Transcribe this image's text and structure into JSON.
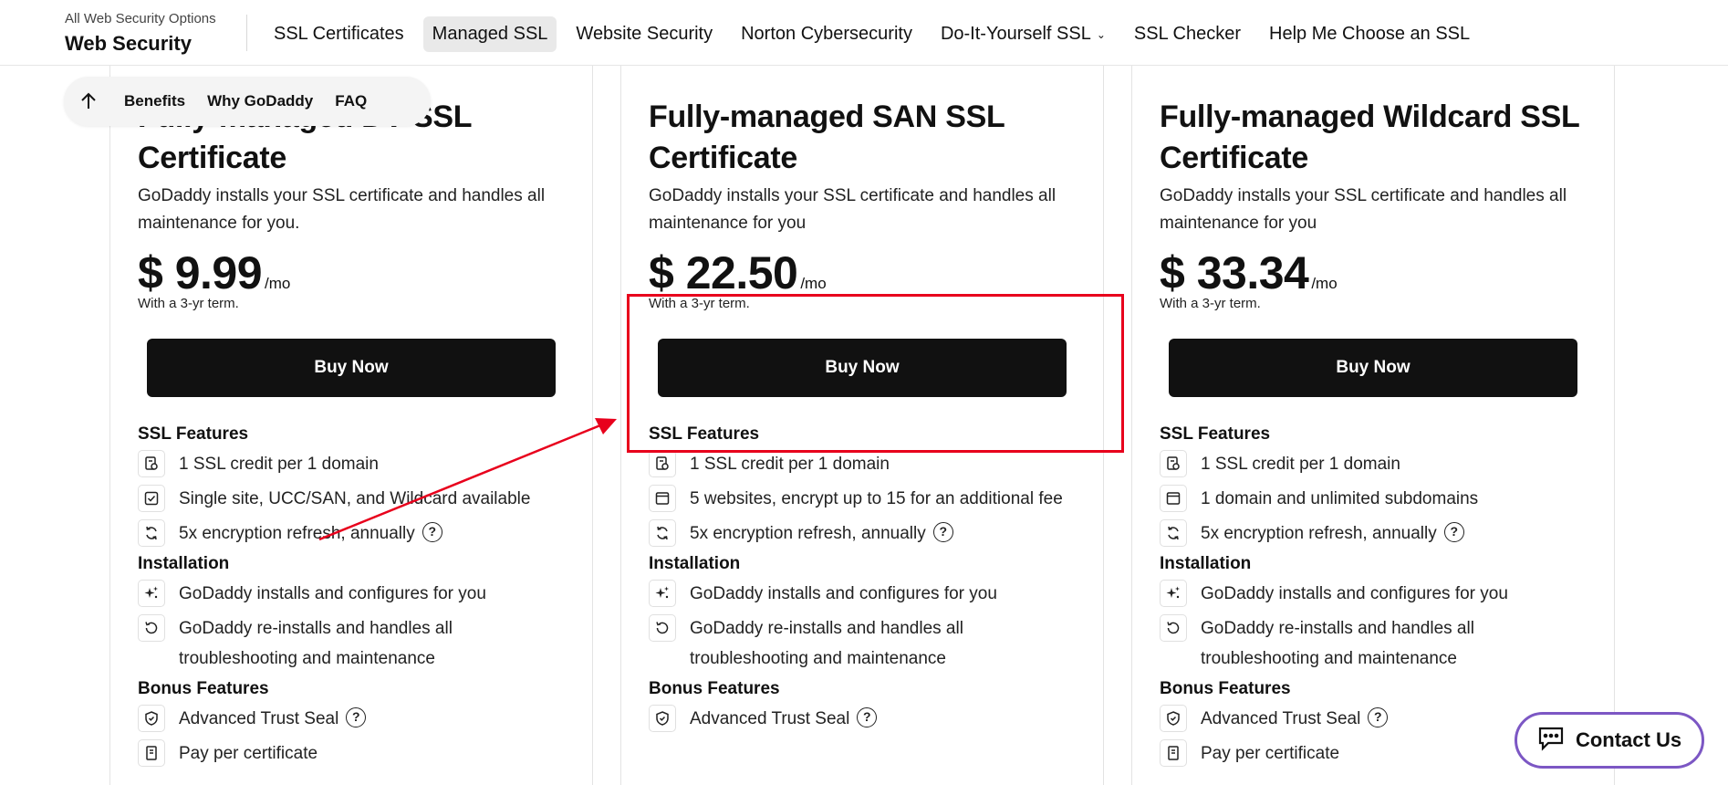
{
  "nav": {
    "brand_sub": "All Web Security Options",
    "brand_title": "Web Security",
    "links": [
      {
        "label": "SSL Certificates"
      },
      {
        "label": "Managed SSL",
        "active": true
      },
      {
        "label": "Website Security"
      },
      {
        "label": "Norton Cybersecurity"
      },
      {
        "label": "Do-It-Yourself SSL",
        "dropdown": true
      },
      {
        "label": "SSL Checker"
      },
      {
        "label": "Help Me Choose an SSL"
      }
    ]
  },
  "subnav": {
    "up_icon": "arrow-up-icon",
    "links": [
      "Benefits",
      "Why GoDaddy",
      "FAQ"
    ]
  },
  "cards": [
    {
      "title": "Fully-managed DV SSL Certificate",
      "description": "GoDaddy installs your SSL certificate and handles all maintenance for you.",
      "price": "$ 9.99",
      "per": "/mo",
      "term": "With a 3-yr term.",
      "buy_label": "Buy Now",
      "ssl_features_heading": "SSL Features",
      "ssl_features": [
        {
          "icon": "credit-icon",
          "text": "1 SSL credit per 1 domain"
        },
        {
          "icon": "check-box-icon",
          "text": "Single site, UCC/SAN, and Wildcard available"
        },
        {
          "icon": "refresh-icon",
          "text": "5x encryption refresh, annually",
          "help": true
        }
      ],
      "installation_heading": "Installation",
      "installation": [
        {
          "icon": "sparkle-icon",
          "text": "GoDaddy installs and configures for you"
        },
        {
          "icon": "reinstall-icon",
          "text": "GoDaddy re-installs and handles all troubleshooting and maintenance"
        }
      ],
      "bonus_heading": "Bonus Features",
      "bonus": [
        {
          "icon": "shield-icon",
          "text": "Advanced Trust Seal",
          "help": true
        },
        {
          "icon": "receipt-icon",
          "text": "Pay per certificate"
        }
      ]
    },
    {
      "title": "Fully-managed SAN SSL Certificate",
      "description": "GoDaddy installs your SSL certificate and handles all maintenance for you",
      "price": "$ 22.50",
      "per": "/mo",
      "term": "With a 3-yr term.",
      "buy_label": "Buy Now",
      "ssl_features_heading": "SSL Features",
      "ssl_features": [
        {
          "icon": "credit-icon",
          "text": "1 SSL credit per 1 domain"
        },
        {
          "icon": "browser-window-icon",
          "text": "5 websites, encrypt up to 15 for an additional fee"
        },
        {
          "icon": "refresh-icon",
          "text": "5x encryption refresh, annually",
          "help": true
        }
      ],
      "installation_heading": "Installation",
      "installation": [
        {
          "icon": "sparkle-icon",
          "text": "GoDaddy installs and configures for you"
        },
        {
          "icon": "reinstall-icon",
          "text": "GoDaddy re-installs and handles all troubleshooting and maintenance"
        }
      ],
      "bonus_heading": "Bonus Features",
      "bonus": [
        {
          "icon": "shield-icon",
          "text": "Advanced Trust Seal",
          "help": true
        }
      ]
    },
    {
      "title": "Fully-managed Wildcard SSL Certificate",
      "description": "GoDaddy installs your SSL certificate and handles all maintenance for you",
      "price": "$ 33.34",
      "per": "/mo",
      "term": "With a 3-yr term.",
      "buy_label": "Buy Now",
      "ssl_features_heading": "SSL Features",
      "ssl_features": [
        {
          "icon": "credit-icon",
          "text": "1 SSL credit per 1 domain"
        },
        {
          "icon": "browser-window-icon",
          "text": "1 domain and unlimited subdomains"
        },
        {
          "icon": "refresh-icon",
          "text": "5x encryption refresh, annually",
          "help": true
        }
      ],
      "installation_heading": "Installation",
      "installation": [
        {
          "icon": "sparkle-icon",
          "text": "GoDaddy installs and configures for you"
        },
        {
          "icon": "reinstall-icon",
          "text": "GoDaddy re-installs and handles all troubleshooting and maintenance"
        }
      ],
      "bonus_heading": "Bonus Features",
      "bonus": [
        {
          "icon": "shield-icon",
          "text": "Advanced Trust Seal",
          "help": true
        },
        {
          "icon": "receipt-icon",
          "text": "Pay per certificate"
        }
      ]
    }
  ],
  "help_symbol": "?",
  "contact": {
    "label": "Contact Us",
    "icon": "chat-icon"
  },
  "colors": {
    "annotation_red": "#e8001c",
    "contact_border": "#7c57c4",
    "buy_button": "#111111",
    "active_nav_bg": "#e9e9e9"
  }
}
